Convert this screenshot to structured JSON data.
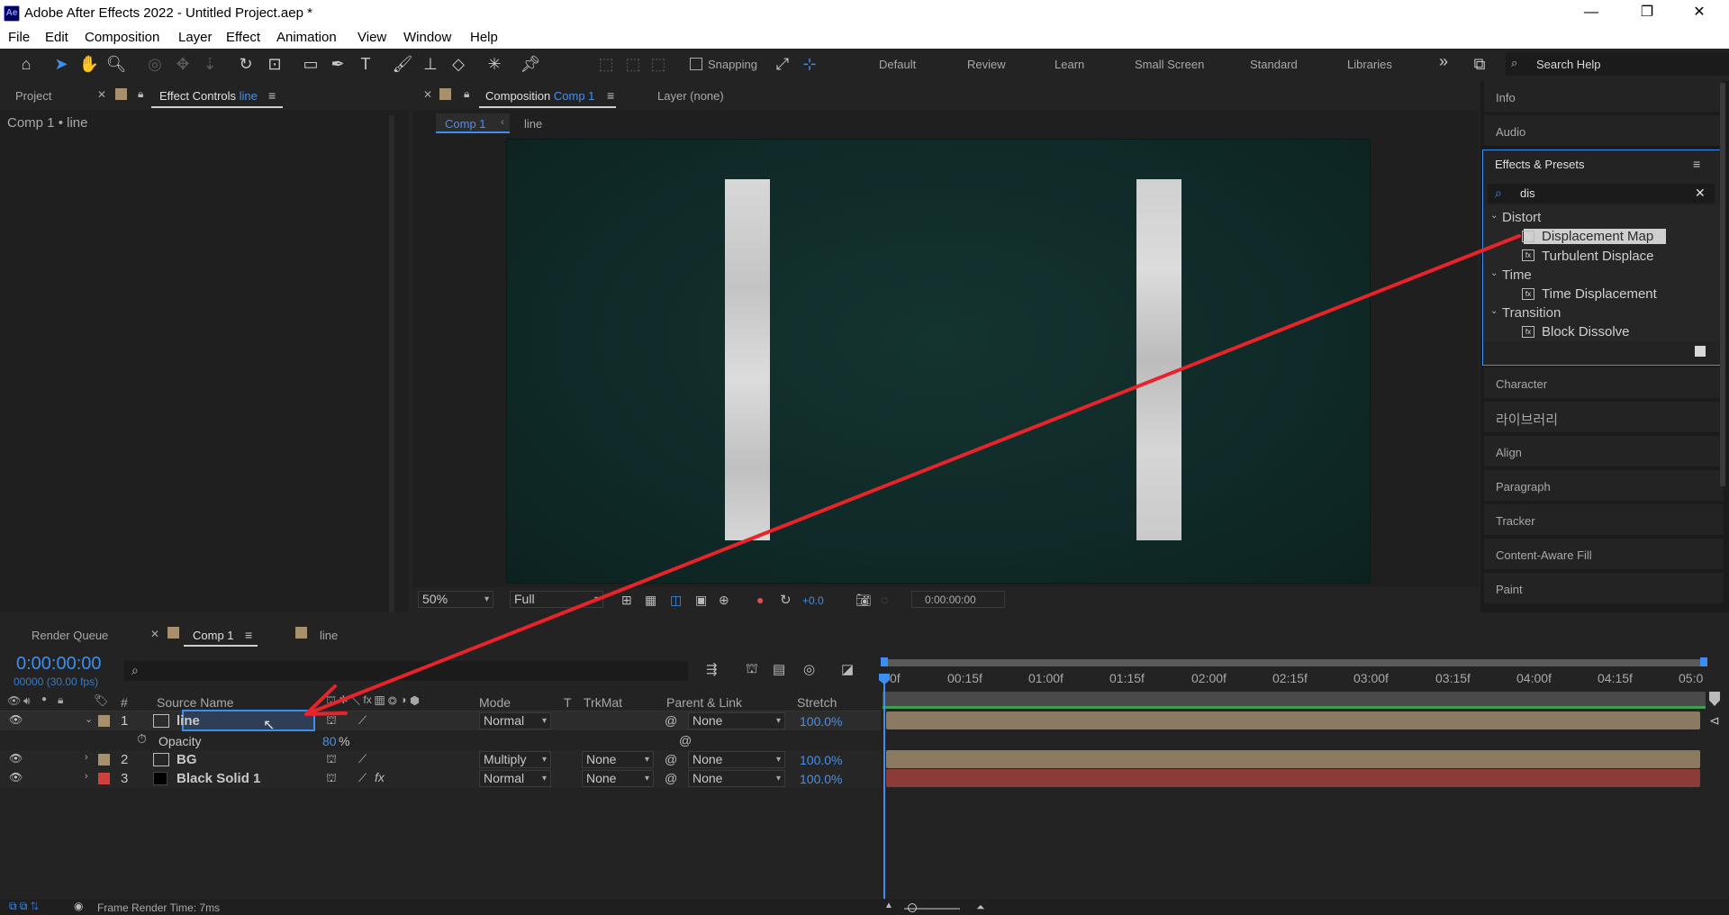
{
  "window": {
    "logo": "Ae",
    "title": "Adobe After Effects 2022 - Untitled Project.aep *",
    "minimize": "—",
    "restore": "❐",
    "close": "✕"
  },
  "menu": [
    "File",
    "Edit",
    "Composition",
    "Layer",
    "Effect",
    "Animation",
    "View",
    "Window",
    "Help"
  ],
  "toolbar": {
    "snapping": "Snapping",
    "workspaces": [
      "Default",
      "Review",
      "Learn",
      "Small Screen",
      "Standard",
      "Libraries"
    ],
    "overflow": "»",
    "search_help": "Search Help"
  },
  "left_panel": {
    "tab_project": "Project",
    "tab_effect_controls": "Effect Controls",
    "tab_effect_controls_layer": "line",
    "breadcrumb": "Comp 1 • line"
  },
  "comp_panel": {
    "tab_label": "Composition",
    "tab_comp": "Comp 1",
    "layer_tab": "Layer (none)",
    "subtab_comp": "Comp 1",
    "subtab_layer": "line",
    "zoom": "50%",
    "resolution": "Full",
    "exposure": "+0.0",
    "timecode": "0:00:00:00"
  },
  "right_panel": {
    "top_items": [
      "Info",
      "Audio"
    ],
    "effects_title": "Effects & Presets",
    "search_value": "dis",
    "groups": [
      {
        "name": "Distort",
        "items": [
          "Displacement Map",
          "Turbulent Displace"
        ]
      },
      {
        "name": "Time",
        "items": [
          "Time Displacement"
        ]
      },
      {
        "name": "Transition",
        "items": [
          "Block Dissolve"
        ]
      }
    ],
    "bottom_items": [
      "Character",
      "라이브러리",
      "Align",
      "Paragraph",
      "Tracker",
      "Content-Aware Fill",
      "Paint"
    ]
  },
  "timeline": {
    "tab_render_queue": "Render Queue",
    "tab_comp": "Comp 1",
    "tab_line": "line",
    "timecode": "0:00:00:00",
    "frame_info": "00000 (30.00 fps)",
    "columns": {
      "num": "#",
      "source_name": "Source Name",
      "mode": "Mode",
      "t": "T",
      "trkmat": "TrkMat",
      "parent": "Parent & Link",
      "stretch": "Stretch"
    },
    "layers": [
      {
        "num": "1",
        "name": "line",
        "color": "#a8906c",
        "mode": "Normal",
        "trkmat": "",
        "parent": "None",
        "stretch": "100.0%"
      },
      {
        "num": "2",
        "name": "BG",
        "color": "#a8906c",
        "mode": "Multiply",
        "trkmat": "None",
        "parent": "None",
        "stretch": "100.0%"
      },
      {
        "num": "3",
        "name": "Black Solid 1",
        "color": "#d0403c",
        "mode": "Normal",
        "trkmat": "None",
        "parent": "None",
        "stretch": "100.0%"
      }
    ],
    "opacity_label": "Opacity",
    "opacity_value": "80",
    "opacity_unit": "%",
    "ruler": [
      "0f",
      "00:15f",
      "01:00f",
      "01:15f",
      "02:00f",
      "02:15f",
      "03:00f",
      "03:15f",
      "04:00f",
      "04:15f",
      "05:0"
    ],
    "frame_render_label": "Frame Render Time:",
    "frame_render_value": "7ms"
  },
  "colors": {
    "accent": "#3c8ff0",
    "arrow": "#e8232a",
    "comp_bg": "#0f2a28",
    "bar_tan": "#8b7a62",
    "bar_red": "#8c3c38"
  }
}
